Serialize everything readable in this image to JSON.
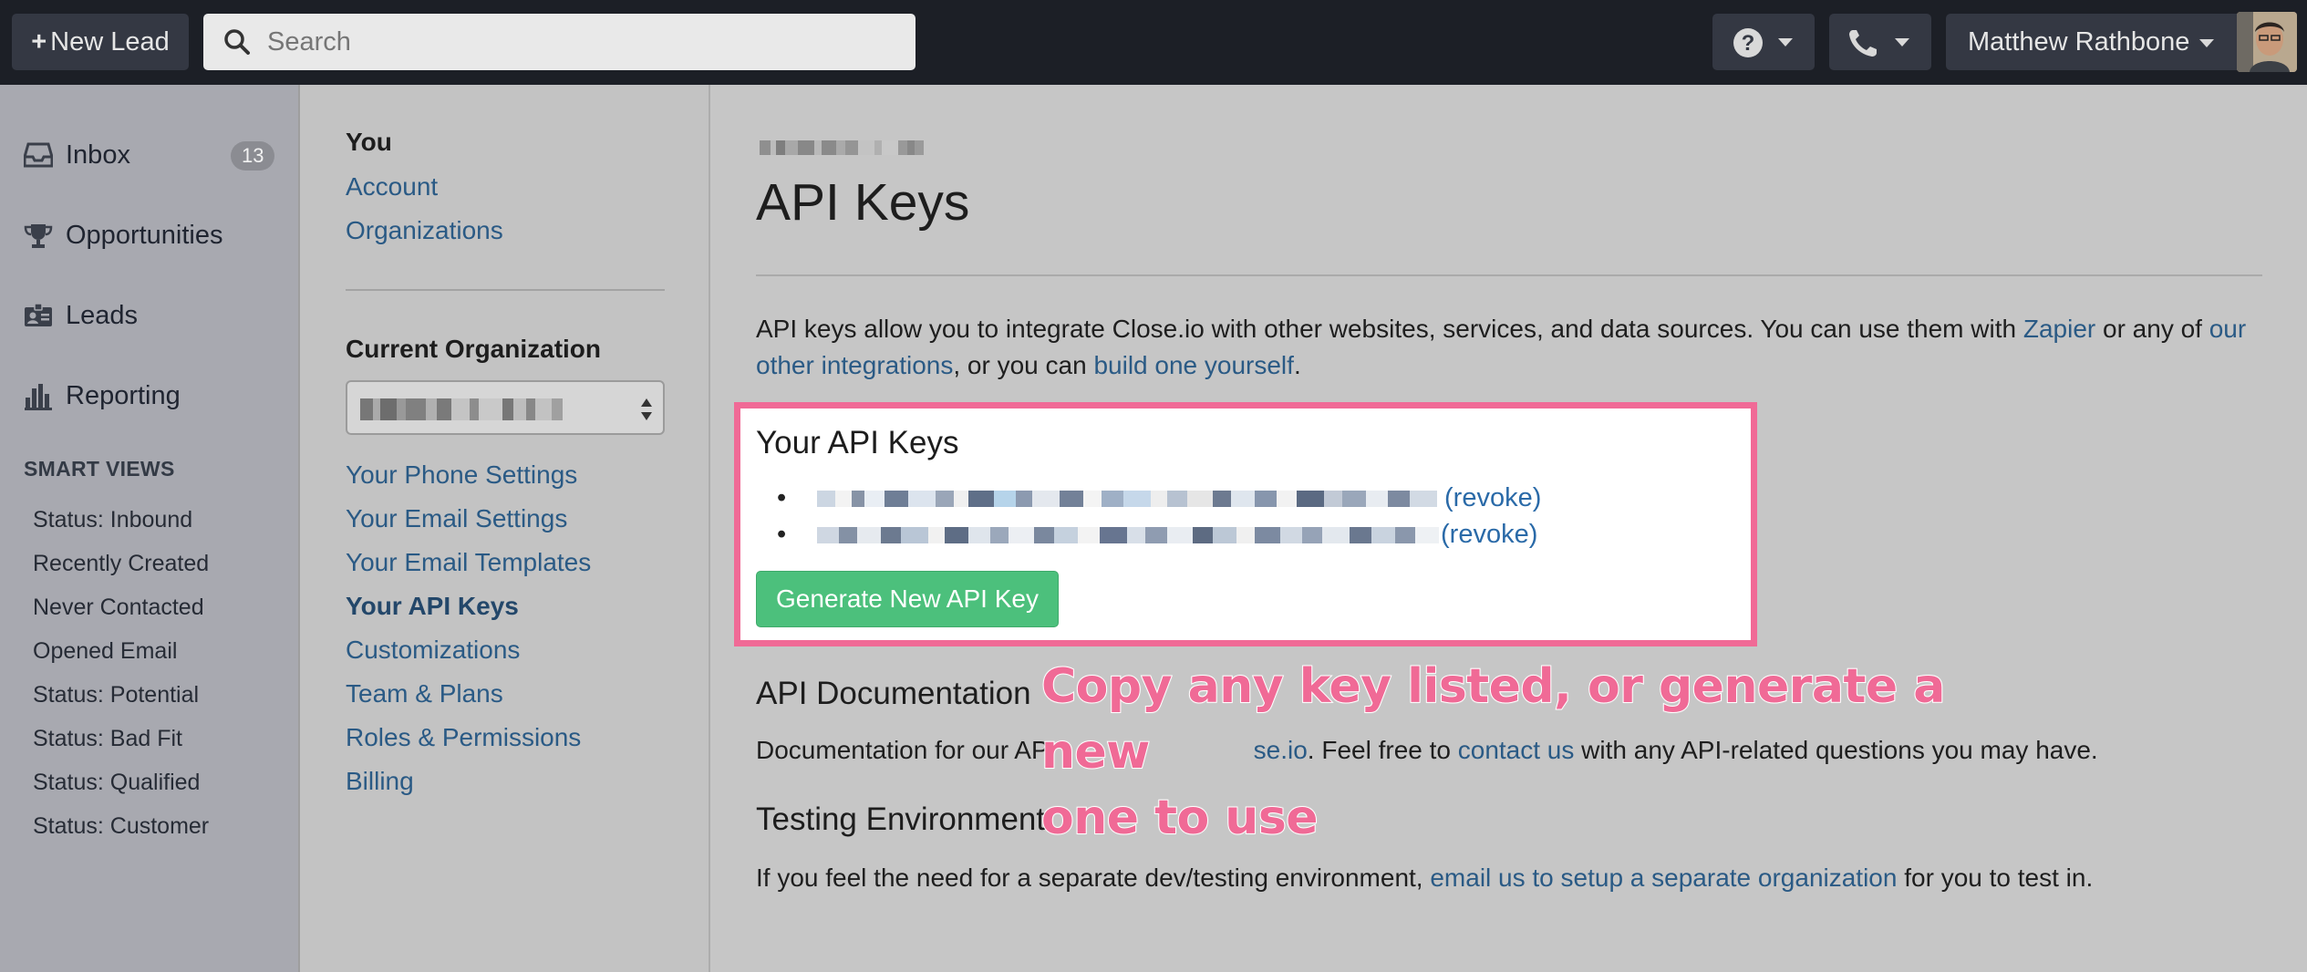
{
  "topbar": {
    "new_lead_label": "New Lead",
    "new_lead_plus": "+",
    "search_placeholder": "Search",
    "user_name": "Matthew Rathbone",
    "help_icon": "question-circle-icon",
    "phone_icon": "phone-icon"
  },
  "sidebar": {
    "items": [
      {
        "label": "Inbox",
        "icon": "inbox-icon",
        "badge": "13"
      },
      {
        "label": "Opportunities",
        "icon": "trophy-icon"
      },
      {
        "label": "Leads",
        "icon": "id-card-icon"
      },
      {
        "label": "Reporting",
        "icon": "bar-chart-icon"
      }
    ],
    "smart_views_heading": "SMART VIEWS",
    "smart_views": [
      "Status: Inbound",
      "Recently Created",
      "Never Contacted",
      "Opened Email",
      "Status: Potential",
      "Status: Bad Fit",
      "Status: Qualified",
      "Status: Customer"
    ]
  },
  "settings_nav": {
    "you_heading": "You",
    "you_links": [
      "Account",
      "Organizations"
    ],
    "org_heading": "Current Organization",
    "org_links": [
      "Your Phone Settings",
      "Your Email Settings",
      "Your Email Templates",
      "Your API Keys",
      "Customizations",
      "Team & Plans",
      "Roles & Permissions",
      "Billing"
    ],
    "active_link": "Your API Keys"
  },
  "main": {
    "title": "API Keys",
    "intro_1": "API keys allow you to integrate Close.io with other websites, services, and data sources. You can use them with ",
    "intro_link_zapier": "Zapier",
    "intro_2": " or any of ",
    "intro_link_integrations": "our other integrations",
    "intro_3": ", or you can ",
    "intro_link_build": "build one yourself",
    "intro_4": ".",
    "keys_heading": "Your API Keys",
    "revoke_label": "(revoke)",
    "generate_button": "Generate New API Key",
    "doc_heading": "API Documentation",
    "doc_text_1": "Documentation for our AP",
    "doc_link_fragment": "se.io",
    "doc_text_2": ". Feel free to ",
    "doc_link_contact": "contact us",
    "doc_text_3": " with any API-related questions you may have.",
    "test_heading": "Testing Environment",
    "test_text_1": "If you feel the need for a separate dev/testing environment, ",
    "test_link": "email us to setup a separate organization",
    "test_text_2": " for you to test in."
  },
  "annotation": {
    "line_1": "Copy any key listed, or generate a new",
    "line_2": "one to use"
  },
  "colors": {
    "topbar_bg": "#1c1f26",
    "link": "#2a5a85",
    "highlight": "#f06a96",
    "generate_button": "#4cc07c"
  }
}
